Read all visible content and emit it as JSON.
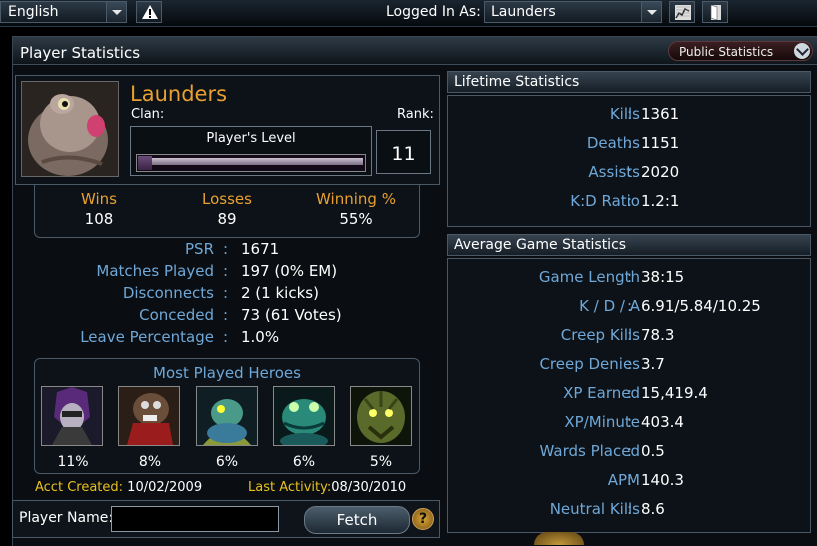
{
  "topbar": {
    "language": "English",
    "logged_in_label": "Logged In As:",
    "username": "Launders"
  },
  "panel": {
    "title": "Player Statistics",
    "public_stats_label": "Public Statistics"
  },
  "player": {
    "name": "Launders",
    "clan_label": "Clan:",
    "rank_label": "Rank:",
    "level_label": "Player's Level",
    "level": "11",
    "level_progress": 0.06
  },
  "record": {
    "wins_label": "Wins",
    "wins": "108",
    "losses_label": "Losses",
    "losses": "89",
    "winpct_label": "Winning %",
    "winpct": "55%"
  },
  "stats": [
    {
      "label": "PSR",
      "value": "1671"
    },
    {
      "label": "Matches Played",
      "value": "197 (0% EM)"
    },
    {
      "label": "Disconnects",
      "value": "2 (1 kicks)"
    },
    {
      "label": "Conceded",
      "value": "73 (61 Votes)"
    },
    {
      "label": "Leave Percentage",
      "value": "1.0%"
    }
  ],
  "heroes": {
    "title": "Most Played Heroes",
    "items": [
      {
        "pct": "11%",
        "icon": "hero-masked-purple-icon"
      },
      {
        "pct": "8%",
        "icon": "hero-beast-rider-icon"
      },
      {
        "pct": "6%",
        "icon": "hero-turtle-icon"
      },
      {
        "pct": "6%",
        "icon": "hero-frog-icon"
      },
      {
        "pct": "5%",
        "icon": "hero-treant-icon"
      }
    ]
  },
  "acct": {
    "created_label": "Acct Created:",
    "created": "10/02/2009",
    "activity_label": "Last Activity:",
    "activity": "08/30/2010"
  },
  "search": {
    "label": "Player Name:",
    "placeholder": "",
    "fetch_label": "Fetch",
    "help_label": "?"
  },
  "lifetime": {
    "title": "Lifetime Statistics",
    "rows": [
      {
        "label": "Kills",
        "value": "1361"
      },
      {
        "label": "Deaths",
        "value": "1151"
      },
      {
        "label": "Assists",
        "value": "2020"
      },
      {
        "label": "K:D Ratio",
        "value": "1.2:1"
      }
    ]
  },
  "average": {
    "title": "Average Game Statistics",
    "rows": [
      {
        "label": "Game Length",
        "value": "38:15"
      },
      {
        "label": "K / D / A",
        "value": "6.91/5.84/10.25"
      },
      {
        "label": "Creep Kills",
        "value": "78.3"
      },
      {
        "label": "Creep Denies",
        "value": "3.7"
      },
      {
        "label": "XP Earned",
        "value": "15,419.4"
      },
      {
        "label": "XP/Minute",
        "value": "403.4"
      },
      {
        "label": "Wards Placed",
        "value": "0.5"
      },
      {
        "label": "APM",
        "value": "140.3"
      },
      {
        "label": "Neutral Kills",
        "value": "8.6"
      }
    ]
  },
  "colors": {
    "accent_orange": "#e8a030",
    "label_blue": "#6fa8d8",
    "date_yellow": "#e8c020"
  }
}
